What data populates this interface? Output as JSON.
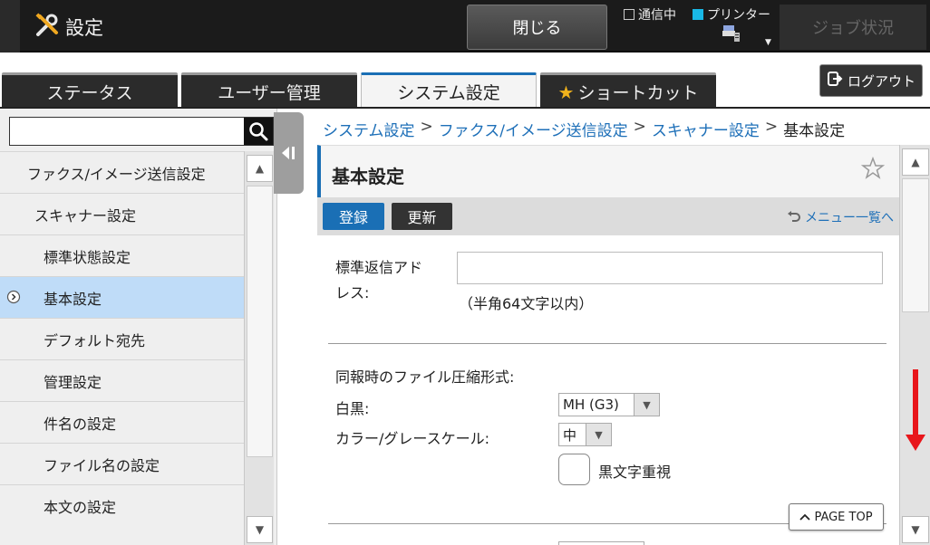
{
  "header": {
    "title": "設定",
    "close_label": "閉じる",
    "status": {
      "comm_label": "通信中",
      "printer_label": "プリンター"
    },
    "job_label": "ジョブ状況"
  },
  "tabs": [
    {
      "label": "ステータス",
      "active": false
    },
    {
      "label": "ユーザー管理",
      "active": false
    },
    {
      "label": "システム設定",
      "active": true
    },
    {
      "label": "ショートカット",
      "active": false
    }
  ],
  "logout_label": "ログアウト",
  "sidebar": {
    "search_value": "",
    "items": [
      {
        "label": "ファクス/イメージ送信設定",
        "level": 1
      },
      {
        "label": "スキャナー設定",
        "level": 2
      },
      {
        "label": "標準状態設定",
        "level": 3
      },
      {
        "label": "基本設定",
        "level": 3,
        "selected": true
      },
      {
        "label": "デフォルト宛先",
        "level": 3
      },
      {
        "label": "管理設定",
        "level": 3
      },
      {
        "label": "件名の設定",
        "level": 3
      },
      {
        "label": "ファイル名の設定",
        "level": 3
      },
      {
        "label": "本文の設定",
        "level": 3
      }
    ]
  },
  "breadcrumb": {
    "items": [
      "システム設定",
      "ファクス/イメージ送信設定",
      "スキャナー設定"
    ],
    "current": "基本設定",
    "separator": ">"
  },
  "main": {
    "title": "基本設定",
    "register_label": "登録",
    "update_label": "更新",
    "menu_link": "メニュー一覧へ",
    "reply_label_line1": "標準返信アド",
    "reply_label_line2": "レス:",
    "reply_value": "",
    "reply_hint": "（半角64文字以内）",
    "broadcast_label": "同報時のファイル圧縮形式:",
    "bw_label": "白黒:",
    "bw_value": "MH (G3)",
    "color_label": "カラー/グレースケール:",
    "color_value": "中",
    "black_text_label": "黒文字重視",
    "page_top": "PAGE TOP"
  },
  "colors": {
    "accent": "#1a6fb5",
    "selected": "#bfdcf8",
    "scroll_hint": "#e8161b"
  }
}
